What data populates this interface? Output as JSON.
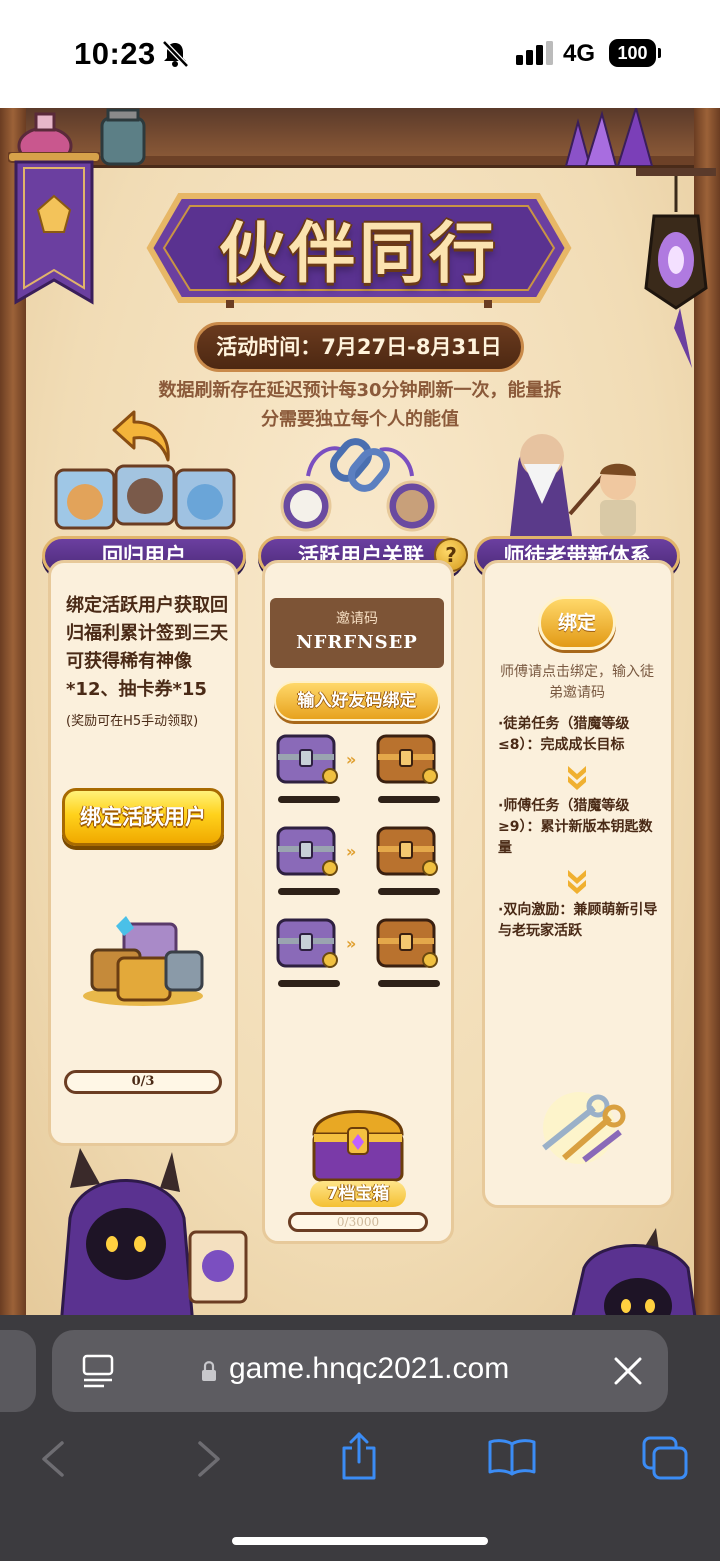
{
  "status_bar": {
    "time": "10:23",
    "network": "4G",
    "battery": "100"
  },
  "game": {
    "title": "伙伴同行",
    "event_time": "活动时间：7月27日-8月31日",
    "notice": "数据刷新存在延迟预计每30分钟刷新一次，能量拆分需要独立每个人的能值",
    "columns": {
      "returning": {
        "header": "回归用户",
        "description": "绑定活跃用户获取回归福利累计签到三天可获得稀有神像*12、抽卡券*15",
        "note": "(奖励可在H5手动领取)",
        "button": "绑定活跃用户",
        "progress": "0/3",
        "progress_value": 0
      },
      "active": {
        "header": "活跃用户关联",
        "help_glyph": "?",
        "invite_label": "邀请码",
        "invite_code": "NFRFNSEP",
        "invite_button": "输入好友码绑定",
        "chest_tier": "7档宝箱",
        "progress": "0/3000",
        "progress_value": 0
      },
      "mentor": {
        "header": "师徒老带新体系",
        "button": "绑定",
        "hint": "师傅请点击绑定，输入徒弟邀请码",
        "rules": [
          "·徒弟任务（猎魔等级≤8）：完成成长目标",
          "·师傅任务（猎魔等级≥9）：累计新版本钥匙数量",
          "·双向激励：兼顾萌新引导与老玩家活跃"
        ]
      }
    }
  },
  "browser": {
    "url": "game.hnqc2021.com",
    "icons": [
      "reader-icon",
      "lock-icon",
      "close-icon",
      "back-icon",
      "forward-icon",
      "share-icon",
      "bookmarks-icon",
      "tabs-icon"
    ]
  },
  "colors": {
    "accent_purple": "#5a3290",
    "gold": "#f4c033",
    "wood": "#7a4e32",
    "parchment": "#f3e0bd"
  }
}
